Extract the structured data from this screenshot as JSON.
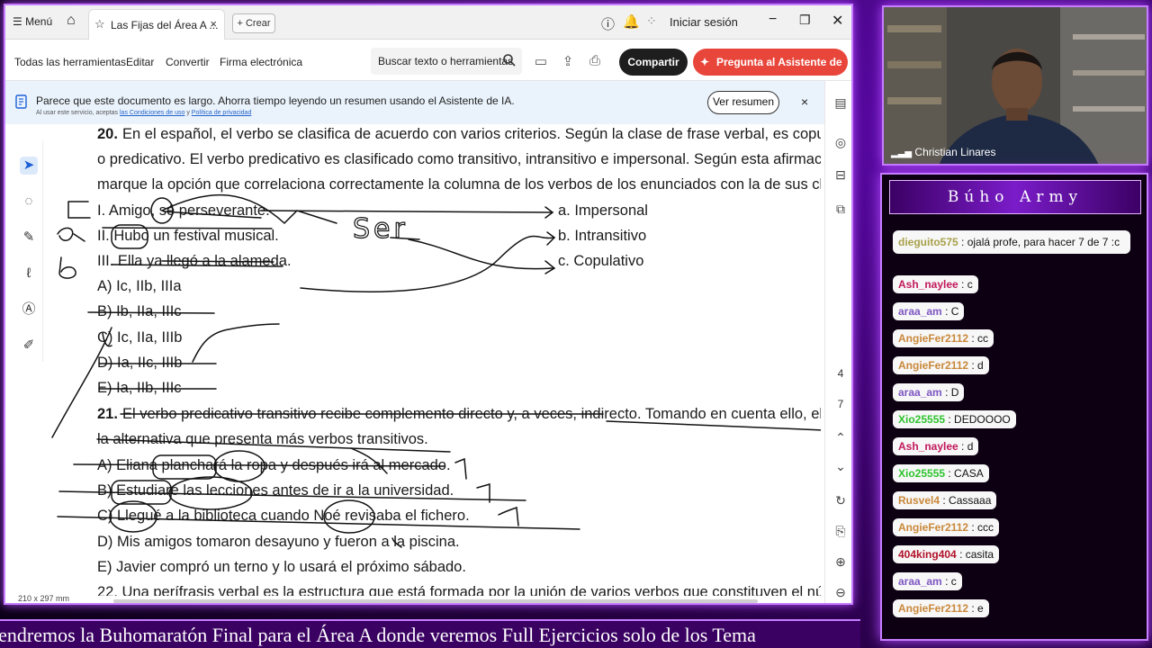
{
  "titlebar": {
    "menu_label": "Menú",
    "tab_title": "Las Fijas del Área A ...",
    "tab_close": "×",
    "new_tab": "+ Crear",
    "signin": "Iniciar sesión"
  },
  "toolbar": {
    "all_tools": "Todas las herramientas",
    "edit": "Editar",
    "convert": "Convertir",
    "esign": "Firma electrónica",
    "search_placeholder": "Buscar texto o herramientas",
    "share": "Compartir",
    "ai_assistant": "Pregunta al Asistente de IA"
  },
  "banner": {
    "text": "Parece que este documento es largo. Ahorra tiempo leyendo un resumen usando el Asistente de IA.",
    "small_prefix": "Al usar este servicio, aceptas",
    "small_link1": "las Condiciones de uso",
    "small_mid": "y",
    "small_link2": "Política de privacidad",
    "button": "Ver resumen",
    "close": "×"
  },
  "page_nav": {
    "current": "4",
    "total": "7"
  },
  "page_size": "210 x 297 mm",
  "document": {
    "q20_num": "20.",
    "q20_l1": "En el español, el verbo se clasifica de acuerdo con varios criterios. Según la clase de frase verbal, es copulativo",
    "q20_l2": "o predicativo. El verbo predicativo es clasificado como transitivo, intransitivo e impersonal. Según esta afirmación,",
    "q20_l3": "marque la opción que correlaciona correctamente la columna de los verbos de los enunciados con la de sus clases.",
    "q20_i": "I. Amigo, sé perseverante.",
    "q20_ii": "II. Hubo un festival musical.",
    "q20_iii": "III. Ella ya llegó a la alameda.",
    "q20_a": "a. Impersonal",
    "q20_b": "b. Intransitivo",
    "q20_c": "c. Copulativo",
    "q20_optA": "A) Ic, IIb, IIIa",
    "q20_optB": "B) Ib, IIa, IIIc",
    "q20_optC": "C) Ic, IIa, IIIb",
    "q20_optD": "D) Ia, IIc, IIIb",
    "q20_optE": "E) Ia, IIb, IIIc",
    "q21_num": "21.",
    "q21_l1": "El verbo predicativo transitivo recibe complemento directo y, a veces, indirecto. Tomando en cuenta ello, elija",
    "q21_l2": "la alternativa que presenta más verbos transitivos.",
    "q21_optA": "A) Eliana planchará la ropa y después irá al mercado.",
    "q21_optB": "B) Estudiaré las lecciones antes de ir a la universidad.",
    "q21_optC": "C) Llegué a la biblioteca cuando Noé revisaba el fichero.",
    "q21_optD": "D) Mis amigos tomaron desayuno y fueron a la piscina.",
    "q21_optE": "E) Javier compró un terno y lo usará el próximo sábado.",
    "q22_partial": "22. Una perífrasis verbal es la estructura que está formada por la unión de varios verbos que constituyen el núcleo"
  },
  "annotations": {
    "ser": "Ser",
    "margin_c": "C",
    "margin_a": "a",
    "margin_b": "b"
  },
  "webcam": {
    "name": "Christian Linares"
  },
  "chat": {
    "title": "Búho Army",
    "messages": [
      {
        "user": "dieguito575",
        "text": ": ojalá profe, para hacer 7 de 7 :c",
        "color": "#a8a04a"
      },
      {
        "user": "Ash_naylee",
        "text": ": c",
        "color": "#c2185b"
      },
      {
        "user": "araa_am",
        "text": ": C",
        "color": "#7e57c2"
      },
      {
        "user": "AngieFer2112",
        "text": ": cc",
        "color": "#c9883a"
      },
      {
        "user": "AngieFer2112",
        "text": ": d",
        "color": "#c9883a"
      },
      {
        "user": "araa_am",
        "text": ": D",
        "color": "#7e57c2"
      },
      {
        "user": "Xio25555",
        "text": ": DEDOOOO",
        "color": "#2ec42e"
      },
      {
        "user": "Ash_naylee",
        "text": ": d",
        "color": "#c2185b"
      },
      {
        "user": "Xio25555",
        "text": ": CASA",
        "color": "#2ec42e"
      },
      {
        "user": "Rusvel4",
        "text": ": Cassaaa",
        "color": "#c9883a"
      },
      {
        "user": "AngieFer2112",
        "text": ": ccc",
        "color": "#c9883a"
      },
      {
        "user": "404king404",
        "text": ": casita",
        "color": "#b0122a"
      },
      {
        "user": "araa_am",
        "text": ": c",
        "color": "#7e57c2"
      },
      {
        "user": "AngieFer2112",
        "text": ": e",
        "color": "#c9883a"
      }
    ]
  },
  "ticker": "tendremos la Buhomaratón Final para el Área A donde veremos Full Ejercicios solo de los Tema"
}
